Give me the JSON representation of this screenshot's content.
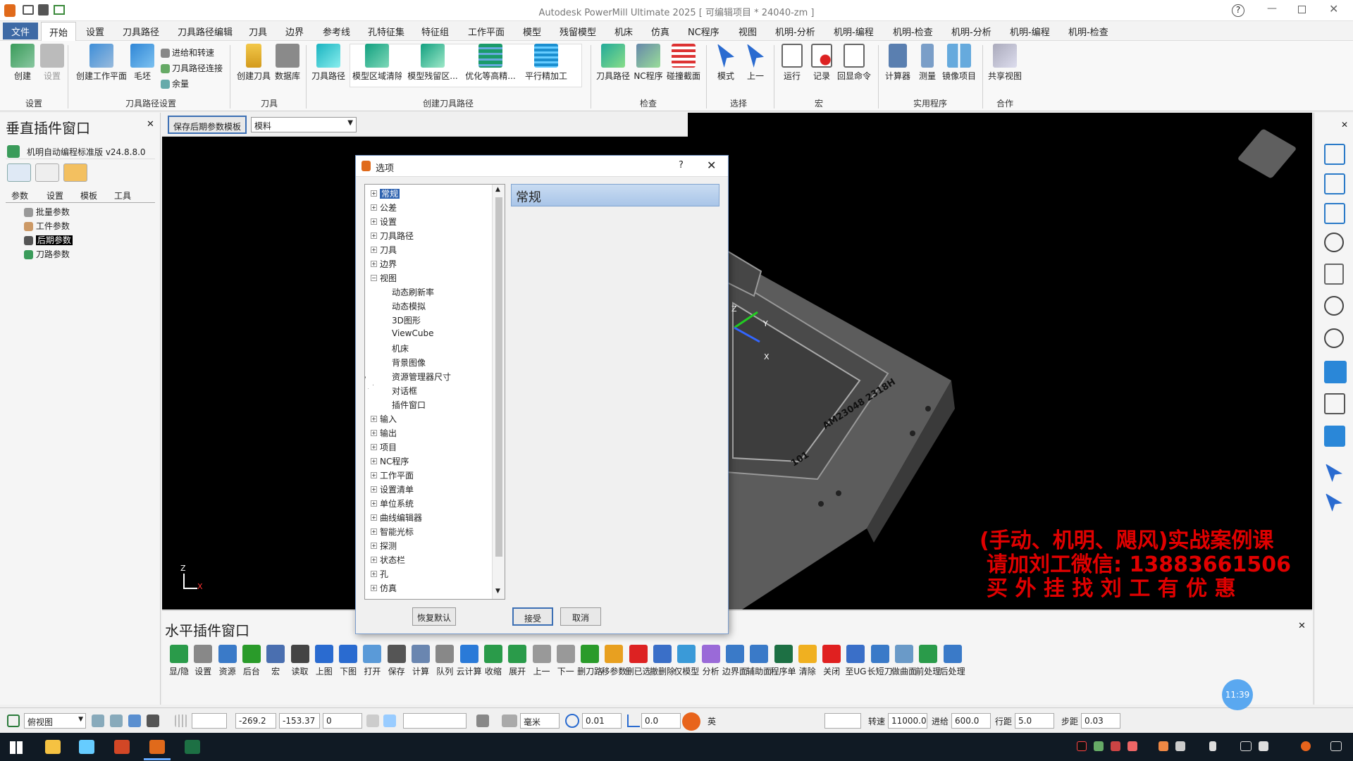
{
  "title": "Autodesk PowerMill Ultimate 2025  [ 可编辑项目 * 24040-zm ]",
  "menu": [
    "文件",
    "开始",
    "设置",
    "刀具路径",
    "刀具路径编辑",
    "刀具",
    "边界",
    "参考线",
    "孔特征集",
    "特征组",
    "工作平面",
    "模型",
    "残留模型",
    "机床",
    "仿真",
    "NC程序",
    "视图",
    "机明-分析",
    "机明-编程",
    "机明-检查",
    "机明-分析",
    "机明-编程",
    "机明-检查"
  ],
  "ribbon": {
    "create": "创建",
    "setting": "设置",
    "create_wp": "创建工作平面",
    "stock": "毛坯",
    "feed": "进给和转速",
    "tp_link": "刀具路径连接",
    "allowance": "余量",
    "create_tool": "创建刀具",
    "db": "数据库",
    "tp": "刀具路径",
    "model_area": "模型区域清除",
    "model_rest": "模型残留区...",
    "opt_const": "优化等高精...",
    "flat_finish": "平行精加工",
    "tp2": "刀具路径",
    "nc": "NC程序",
    "collision": "碰撞截面",
    "mode": "模式",
    "prev": "上一",
    "run": "运行",
    "record": "记录",
    "echo": "回显命令",
    "calc": "计算器",
    "measure": "测量",
    "mirror": "镜像项目",
    "share": "共享视图",
    "groups": {
      "setting": "设置",
      "tp_setting": "刀具路径设置",
      "tool": "刀具",
      "create_tp": "创建刀具路径",
      "check": "检查",
      "select": "选择",
      "macro": "宏",
      "util": "实用程序",
      "coop": "合作"
    }
  },
  "left": {
    "title": "垂直插件窗口",
    "plugin": "机明自动编程标准版 v24.8.8.0",
    "tabs": [
      "参数",
      "设置",
      "模板",
      "工具"
    ],
    "items": [
      "批量参数",
      "工件参数",
      "后期参数",
      "刀路参数"
    ]
  },
  "top_strip": {
    "save_btn": "保存后期参数模板",
    "select": "模料"
  },
  "dialog": {
    "title": "选项",
    "help": "?",
    "header": "常规",
    "tree": [
      {
        "l": "常规",
        "d": 0,
        "sel": true
      },
      {
        "l": "公差",
        "d": 0
      },
      {
        "l": "设置",
        "d": 0
      },
      {
        "l": "刀具路径",
        "d": 0
      },
      {
        "l": "刀具",
        "d": 0
      },
      {
        "l": "边界",
        "d": 0
      },
      {
        "l": "视图",
        "d": 0,
        "open": true
      },
      {
        "l": "动态刷新率",
        "d": 1
      },
      {
        "l": "动态模拟",
        "d": 1
      },
      {
        "l": "3D图形",
        "d": 1
      },
      {
        "l": "ViewCube",
        "d": 1
      },
      {
        "l": "机床",
        "d": 1
      },
      {
        "l": "背景图像",
        "d": 1
      },
      {
        "l": "资源管理器尺寸",
        "d": 1
      },
      {
        "l": "对话框",
        "d": 1
      },
      {
        "l": "插件窗口",
        "d": 1
      },
      {
        "l": "输入",
        "d": 0
      },
      {
        "l": "输出",
        "d": 0
      },
      {
        "l": "项目",
        "d": 0
      },
      {
        "l": "NC程序",
        "d": 0
      },
      {
        "l": "工作平面",
        "d": 0
      },
      {
        "l": "设置清单",
        "d": 0
      },
      {
        "l": "单位系统",
        "d": 0
      },
      {
        "l": "曲线编辑器",
        "d": 0
      },
      {
        "l": "智能光标",
        "d": 0
      },
      {
        "l": "探测",
        "d": 0
      },
      {
        "l": "状态栏",
        "d": 0
      },
      {
        "l": "孔",
        "d": 0
      },
      {
        "l": "仿真",
        "d": 0
      }
    ],
    "restore": "恢复默认",
    "accept": "接受",
    "cancel": "取消"
  },
  "viewport": {
    "watermark": [
      "(手动、机明、飓风)实战案例课",
      "请加刘工微信: 13883661506",
      "买 外 挂 找 刘 工 有 优 惠"
    ],
    "engrave1": "AM23048  2318H",
    "engrave2": "101"
  },
  "hpanel": {
    "title": "水平插件窗口",
    "tools": [
      "显/隐",
      "设置",
      "资源",
      "后台",
      "宏",
      "读取",
      "上图",
      "下图",
      "打开",
      "保存",
      "计算",
      "队列",
      "云计算",
      "收缩",
      "展开",
      "上一",
      "下一",
      "删刀路",
      "移参数",
      "删已选",
      "撤删除",
      "仅模型",
      "分析",
      "边界面",
      "辅助面",
      "程序单",
      "清除",
      "关闭",
      "至UG",
      "长短刀",
      "做曲面",
      "前处理",
      "后处理"
    ]
  },
  "status": {
    "view": "俯视图",
    "x": "-269.2",
    "y": "-153.37",
    "z": "0",
    "unit": "毫米",
    "tol": "0.01",
    "val": "0.0",
    "ime": "英",
    "speed_label": "转速",
    "speed": "11000.0",
    "feed_label": "进给",
    "feed": "600.0",
    "step_label": "行距",
    "step": "5.0",
    "stepdown_label": "步距",
    "stepdown": "0.03"
  },
  "clock": "11:39"
}
